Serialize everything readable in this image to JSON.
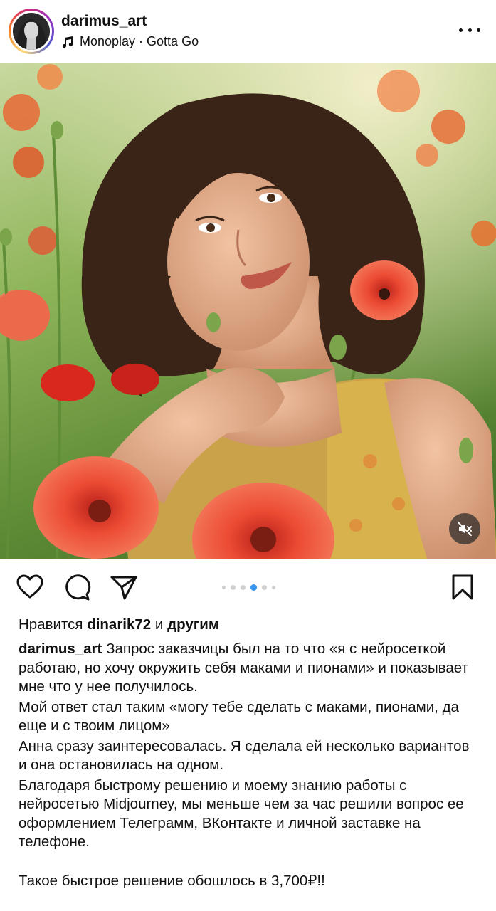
{
  "post": {
    "username": "darimus_art",
    "audio": "Monoplay · Gotta Go"
  },
  "icons": {
    "music": "music-note-icon",
    "more": "more-horizontal-icon",
    "like": "heart-icon",
    "comment": "comment-icon",
    "share": "send-icon",
    "save": "bookmark-icon",
    "mute": "sound-off-icon"
  },
  "carousel": {
    "total": 6,
    "active_index": 3
  },
  "likes": {
    "prefix": "Нравится",
    "user": "dinarik72",
    "middle": "и",
    "suffix": "другим"
  },
  "caption": {
    "author": "darimus_art",
    "paragraphs": [
      "Запрос заказчицы был на то что «я с нейросеткой работаю, но хочу окружить себя маками и пионами» и показывает мне что у нее получилось.",
      "Мой ответ стал таким «могу тебе сделать с маками, пионами, да еще и с твоим лицом»",
      "Анна сразу заинтересовалась. Я сделала ей несколько вариантов и она остановилась на одном.",
      "Благодаря быстрому решению и моему знанию работы с нейросетью Midjourney, мы меньше чем за час решили вопрос ее оформлением Телеграмм, ВКонтакте и личной заставке на телефоне.",
      "Такое быстрое решение обошлось в 3,700₽!!"
    ]
  },
  "colors": {
    "accent": "#3897f0",
    "text": "#111111",
    "poppy": "#e8432b"
  }
}
